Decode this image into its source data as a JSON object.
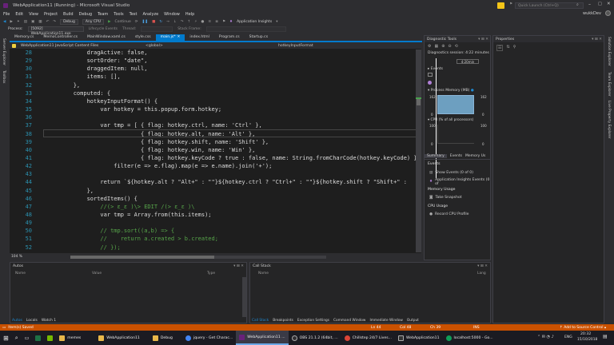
{
  "window": {
    "title": "WebApplication11 (Running) - Microsoft Visual Studio",
    "user": "wukkDev",
    "quick_launch_placeholder": "Quick Launch (Ctrl+Q)"
  },
  "menu": [
    "File",
    "Edit",
    "View",
    "Project",
    "Build",
    "Debug",
    "Team",
    "Tools",
    "Test",
    "Analyze",
    "Window",
    "Help"
  ],
  "toolbar": {
    "debug_config": "Debug",
    "platform": "Any CPU",
    "continue_label": "Continue",
    "app_insights_label": "Application Insights"
  },
  "toolbar2": {
    "process_label": "Process:",
    "process_value": "[5092] WebApplication11.exe",
    "lifecycle_label": "Lifecycle Events",
    "thread_label": "Thread:",
    "stack_frame_label": "Stack Frame:"
  },
  "editor_tabs": [
    "Memory.cs",
    "MemoController.cs",
    "MainWindow.xaml.cs",
    "style.css",
    "main.js*",
    "index.html",
    "Program.cs",
    "Startup.cs"
  ],
  "active_tab_index": 4,
  "nav": {
    "project": "WebApplication11 JavaScript Content Files",
    "scope": "<global>",
    "member": "hotkeyInputFormat"
  },
  "code_lines": [
    {
      "n": "28",
      "t": "            dragActive: false,"
    },
    {
      "n": "29",
      "t": "            sortOrder: \"date\","
    },
    {
      "n": "30",
      "t": "            draggedItem: null,"
    },
    {
      "n": "31",
      "t": "            items: [],"
    },
    {
      "n": "32",
      "t": "        },"
    },
    {
      "n": "33",
      "t": "        computed: {"
    },
    {
      "n": "34",
      "t": "            hotkeyInputFormat() {"
    },
    {
      "n": "35",
      "t": "                var hotkey = this.popup.form.hotkey;"
    },
    {
      "n": "36",
      "t": ""
    },
    {
      "n": "37",
      "t": "                var tmp = [ { flag: hotkey.ctrl, name: 'Ctrl' },"
    },
    {
      "n": "38",
      "t": "                            { flag: hotkey.alt, name: 'Alt' },"
    },
    {
      "n": "39",
      "t": "                            { flag: hotkey.shift, name: 'Shift' },"
    },
    {
      "n": "40",
      "t": "                            { flag: hotkey.win, name: 'Win' },"
    },
    {
      "n": "41",
      "t": "                            { flag: hotkey.keyCode ? true : false, name: String.fromCharCode(hotkey.keyCode) }]."
    },
    {
      "n": "42",
      "t": "                    filter(e => e.flag).map(e => e.name).join('+');"
    },
    {
      "n": "43",
      "t": ""
    },
    {
      "n": "44",
      "t": "                return `${hotkey.alt ? \"Alt+\" : \"\"}${hotkey.ctrl ? \"Ctrl+\" : \"\"}${hotkey.shift ? \"Shift+\" :"
    },
    {
      "n": "45",
      "t": "            },"
    },
    {
      "n": "46",
      "t": "            sortedItems() {"
    },
    {
      "n": "47",
      "t": "                //(> ε_ε )\\> EDIT /(> ε_ε )\\"
    },
    {
      "n": "48",
      "t": "                var tmp = Array.from(this.items);"
    },
    {
      "n": "49",
      "t": ""
    },
    {
      "n": "50",
      "t": "                // tmp.sort((a,b) => {"
    },
    {
      "n": "51",
      "t": "                //    return a.created > b.created;"
    },
    {
      "n": "52",
      "t": "                // });"
    }
  ],
  "zoom": "104 %",
  "autos": {
    "title": "Autos",
    "cols": [
      "Name",
      "Value",
      "Type"
    ],
    "tabs": [
      "Autos",
      "Locals",
      "Watch 1"
    ]
  },
  "callstack": {
    "title": "Call Stack",
    "cols": [
      "Name",
      "Lang"
    ],
    "tabs": [
      "Call Stack",
      "Breakpoints",
      "Exception Settings",
      "Command Window",
      "Immediate Window",
      "Output"
    ]
  },
  "diagnostics": {
    "title": "Diagnostic Tools",
    "session": "Diagnostics session: 4:22 minutes",
    "time_marker": "4:20min",
    "events_label": "Events",
    "memory_label": "Process Memory (MB)",
    "memory_max": "162",
    "memory_min": "0",
    "cpu_label": "CPU (% of all processors)",
    "cpu_max": "100",
    "cpu_min": "0",
    "tabs": [
      "Summary",
      "Events",
      "Memory Us"
    ],
    "sections": [
      {
        "h": "Events",
        "items": [
          "Show Events (0 of 0)",
          "Application Insights Events (0 of"
        ]
      },
      {
        "h": "Memory Usage",
        "items": [
          "Take Snapshot"
        ]
      },
      {
        "h": "CPU Usage",
        "items": [
          "Record CPU Profile"
        ]
      }
    ]
  },
  "properties": {
    "title": "Properties"
  },
  "side_tabs_left": [
    "Server Explorer",
    "Toolbox"
  ],
  "side_tabs_right": [
    "Solution Explorer",
    "Team Explorer",
    "Live Property Explorer"
  ],
  "status": {
    "left": "Item(s) Saved",
    "ln": "Ln 44",
    "col": "Col 48",
    "ch": "Ch 39",
    "ins": "INS",
    "source_control": "Add to Source Control"
  },
  "taskbar": {
    "items": [
      "memes",
      "WebApplication11",
      "Debug",
      "jquery - Get Charac...",
      "WebApplication11 ...",
      "OBS 21.1.2 (64bit, ...",
      "Chillstep 24/7 Lives...",
      "WebApplication11",
      "localhost:5000 - Go..."
    ],
    "active_index": 4,
    "lang": "ENG",
    "time": "20:32",
    "date": "15/10/2018"
  },
  "colors": {
    "accent": "#007acc",
    "status": "#ca5100",
    "editor_bg": "#1e1e1e",
    "chrome": "#2d2d30"
  }
}
